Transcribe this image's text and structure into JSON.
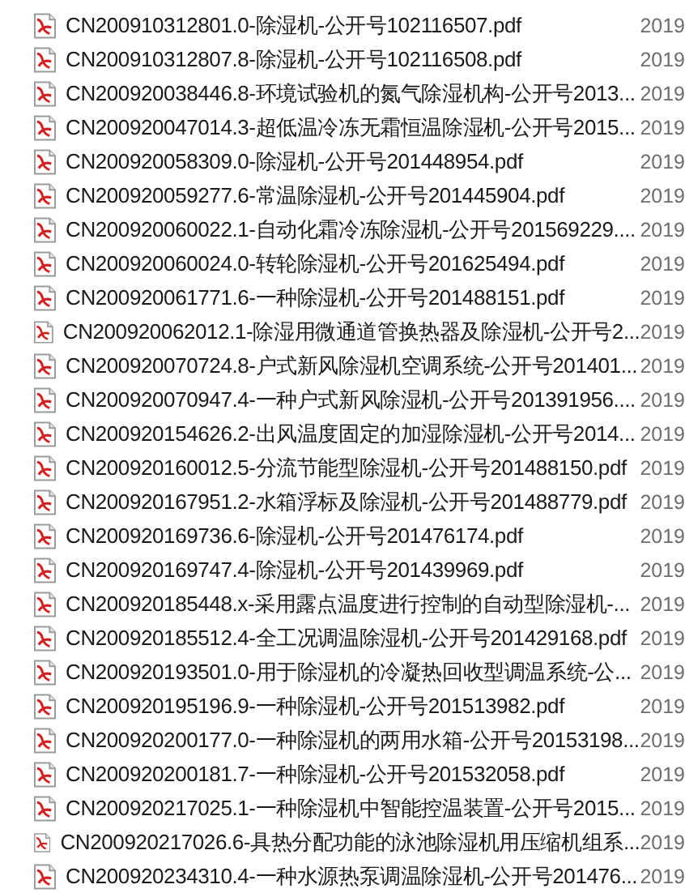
{
  "files": [
    {
      "name": "CN200910312801.0-除湿机-公开号102116507.pdf",
      "date": "2019"
    },
    {
      "name": "CN200910312807.8-除湿机-公开号102116508.pdf",
      "date": "2019"
    },
    {
      "name": "CN200920038446.8-环境试验机的氮气除湿机构-公开号2013...",
      "date": "2019"
    },
    {
      "name": "CN200920047014.3-超低温冷冻无霜恒温除湿机-公开号2015...",
      "date": "2019"
    },
    {
      "name": "CN200920058309.0-除湿机-公开号201448954.pdf",
      "date": "2019"
    },
    {
      "name": "CN200920059277.6-常温除湿机-公开号201445904.pdf",
      "date": "2019"
    },
    {
      "name": "CN200920060022.1-自动化霜冷冻除湿机-公开号201569229....",
      "date": "2019"
    },
    {
      "name": "CN200920060024.0-转轮除湿机-公开号201625494.pdf",
      "date": "2019"
    },
    {
      "name": "CN200920061771.6-一种除湿机-公开号201488151.pdf",
      "date": "2019"
    },
    {
      "name": "CN200920062012.1-除湿用微通道管换热器及除湿机-公开号2...",
      "date": "2019"
    },
    {
      "name": "CN200920070724.8-户式新风除湿机空调系统-公开号201401...",
      "date": "2019"
    },
    {
      "name": "CN200920070947.4-一种户式新风除湿机-公开号201391956....",
      "date": "2019"
    },
    {
      "name": "CN200920154626.2-出风温度固定的加湿除湿机-公开号2014...",
      "date": "2019"
    },
    {
      "name": "CN200920160012.5-分流节能型除湿机-公开号201488150.pdf",
      "date": "2019"
    },
    {
      "name": "CN200920167951.2-水箱浮标及除湿机-公开号201488779.pdf",
      "date": "2019"
    },
    {
      "name": "CN200920169736.6-除湿机-公开号201476174.pdf",
      "date": "2019"
    },
    {
      "name": "CN200920169747.4-除湿机-公开号201439969.pdf",
      "date": "2019"
    },
    {
      "name": "CN200920185448.x-采用露点温度进行控制的自动型除湿机-...",
      "date": "2019"
    },
    {
      "name": "CN200920185512.4-全工况调温除湿机-公开号201429168.pdf",
      "date": "2019"
    },
    {
      "name": "CN200920193501.0-用于除湿机的冷凝热回收型调温系统-公...",
      "date": "2019"
    },
    {
      "name": "CN200920195196.9-一种除湿机-公开号201513982.pdf",
      "date": "2019"
    },
    {
      "name": "CN200920200177.0-一种除湿机的两用水箱-公开号20153198...",
      "date": "2019"
    },
    {
      "name": "CN200920200181.7-一种除湿机-公开号201532058.pdf",
      "date": "2019"
    },
    {
      "name": "CN200920217025.1-一种除湿机中智能控温装置-公开号2015...",
      "date": "2019"
    },
    {
      "name": "CN200920217026.6-具热分配功能的泳池除湿机用压缩机组系...",
      "date": "2019"
    },
    {
      "name": "CN200920234310.4-一种水源热泵调温除湿机-公开号201476...",
      "date": "2019"
    }
  ]
}
